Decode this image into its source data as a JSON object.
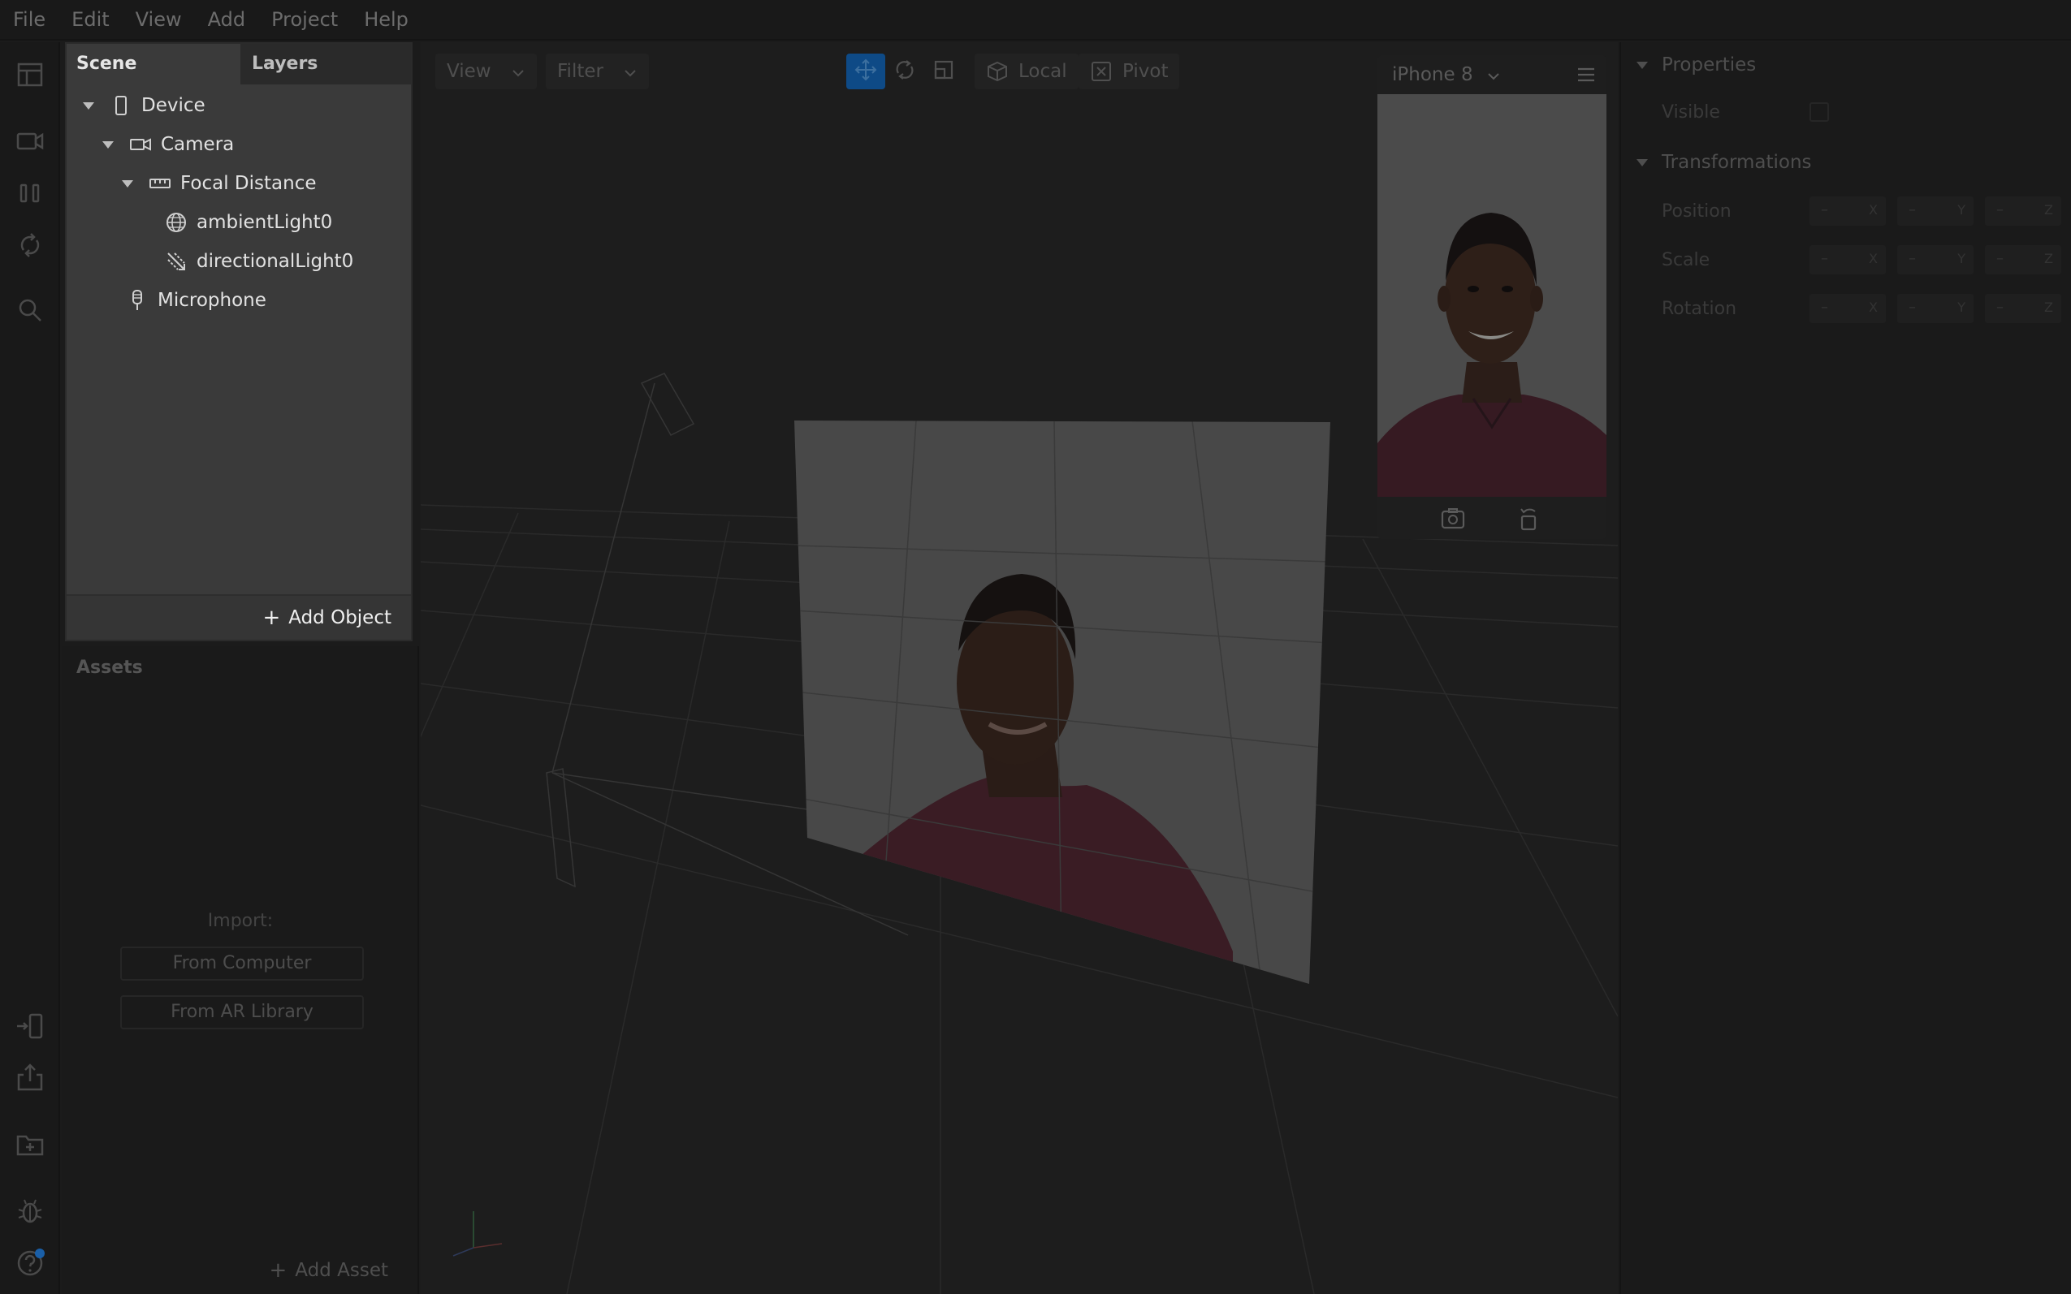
{
  "menu": [
    "File",
    "Edit",
    "View",
    "Add",
    "Project",
    "Help"
  ],
  "scene": {
    "tabs": [
      "Scene",
      "Layers"
    ],
    "tree": [
      {
        "label": "Device",
        "icon": "device-icon"
      },
      {
        "label": "Camera",
        "icon": "camera-icon"
      },
      {
        "label": "Focal Distance",
        "icon": "ruler-icon"
      },
      {
        "label": "ambientLight0",
        "icon": "ambient-light-icon"
      },
      {
        "label": "directionalLight0",
        "icon": "directional-light-icon"
      },
      {
        "label": "Microphone",
        "icon": "microphone-icon"
      }
    ],
    "add_object": "Add Object"
  },
  "assets": {
    "title": "Assets",
    "import_label": "Import:",
    "from_computer": "From Computer",
    "from_ar_library": "From AR Library",
    "add_asset": "Add Asset"
  },
  "viewport": {
    "view": "View",
    "filter": "Filter",
    "local": "Local",
    "pivot": "Pivot"
  },
  "preview": {
    "device": "iPhone 8"
  },
  "properties": {
    "section_properties": "Properties",
    "visible": "Visible",
    "section_transformations": "Transformations",
    "rows": [
      {
        "label": "Position",
        "values": [
          "–",
          "–",
          "–"
        ]
      },
      {
        "label": "Scale",
        "values": [
          "–",
          "–",
          "–"
        ]
      },
      {
        "label": "Rotation",
        "values": [
          "–",
          "–",
          "–"
        ]
      }
    ],
    "axes": [
      "X",
      "Y",
      "Z"
    ]
  },
  "colors": {
    "accent": "#0e4a86",
    "notification": "#1a5fa8"
  }
}
